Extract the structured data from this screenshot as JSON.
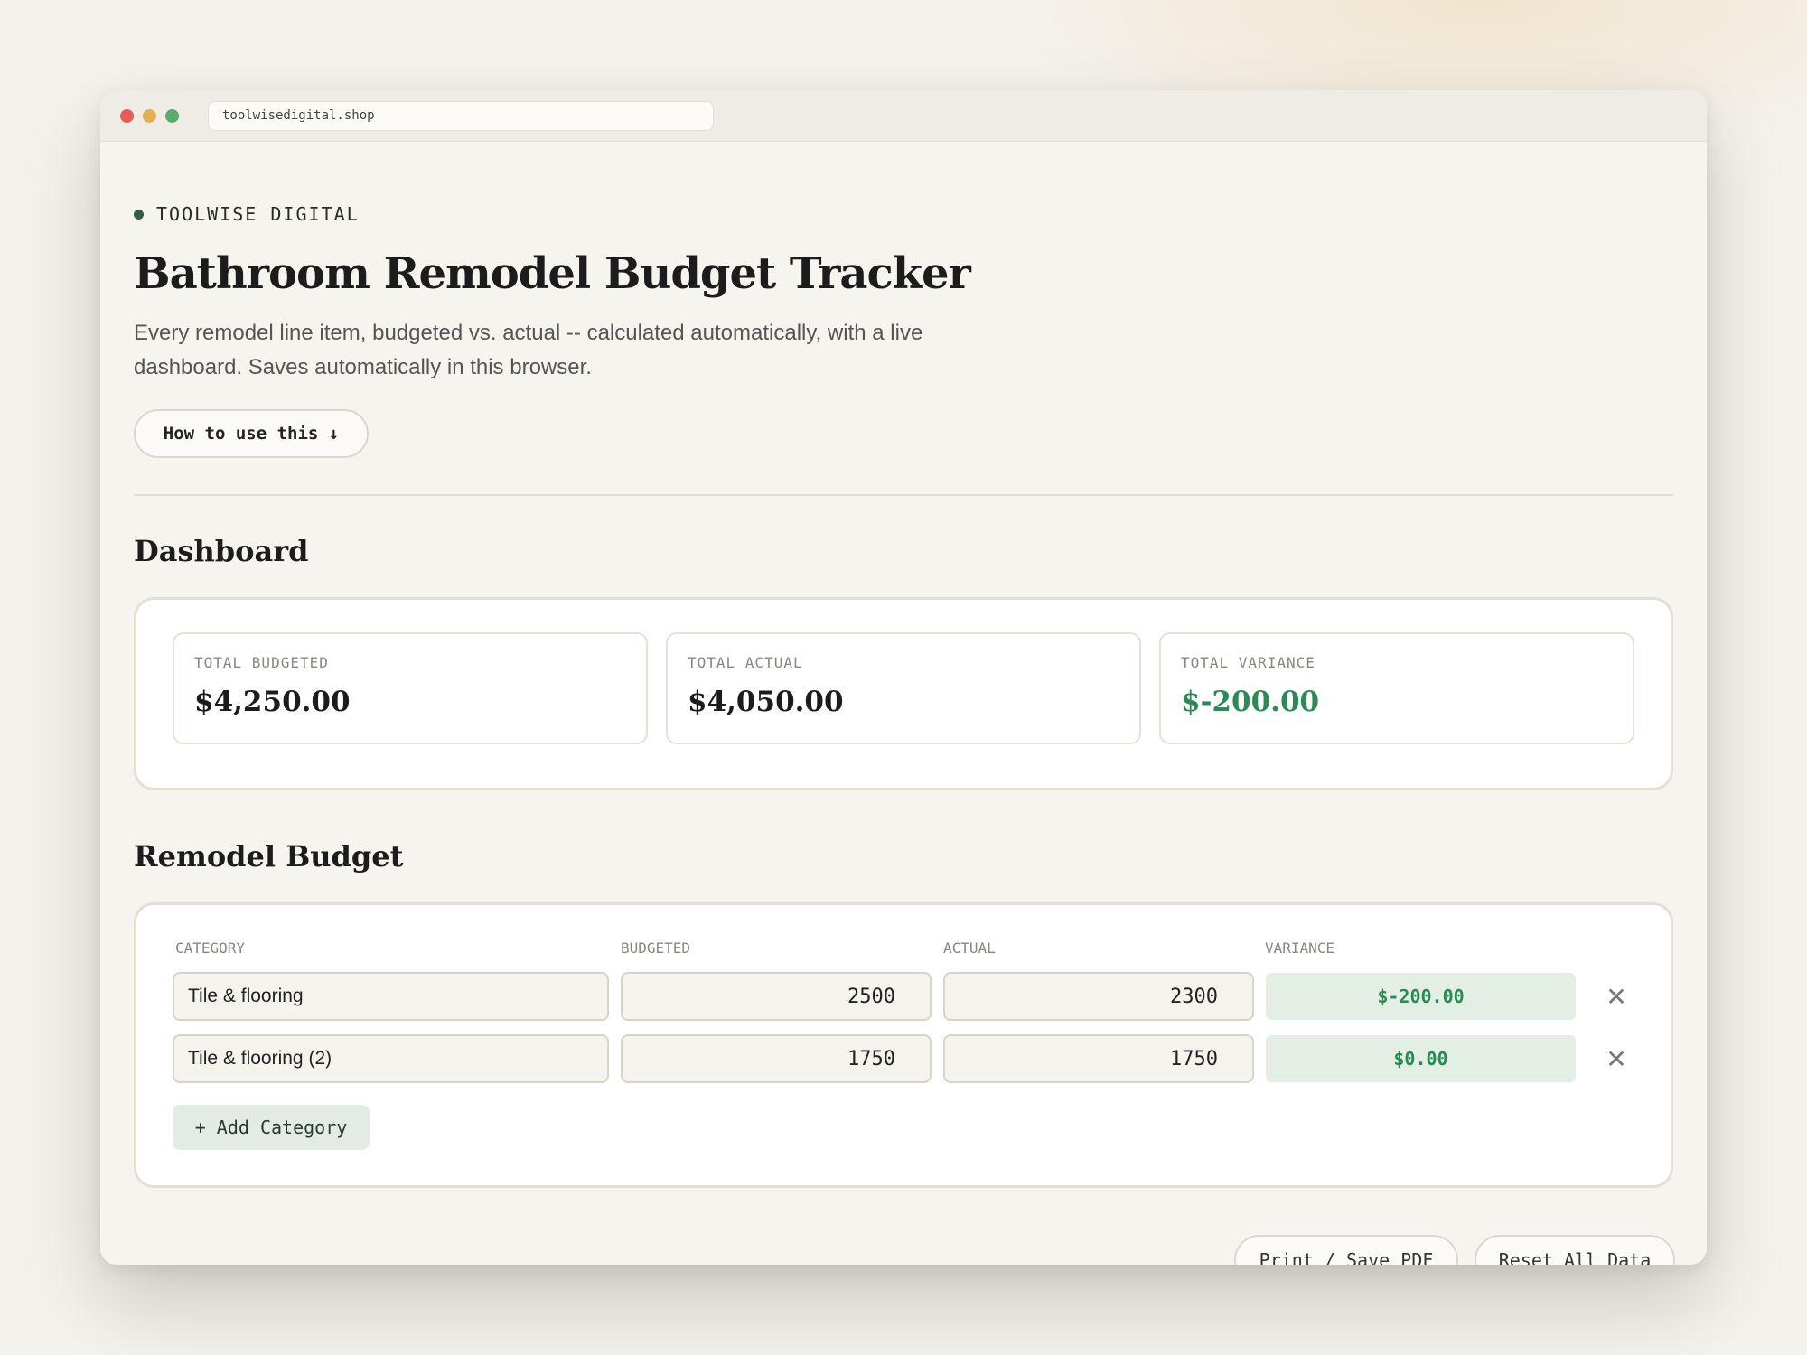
{
  "browser": {
    "url": "toolwisedigital.shop"
  },
  "header": {
    "brand": "TOOLWISE DIGITAL",
    "title": "Bathroom Remodel Budget Tracker",
    "subtitle": "Every remodel line item, budgeted vs. actual -- calculated automatically, with a live dashboard. Saves automatically in this browser.",
    "howto_label": "How to use this ↓"
  },
  "dashboard": {
    "heading": "Dashboard",
    "stats": [
      {
        "label": "TOTAL BUDGETED",
        "value": "$4,250.00"
      },
      {
        "label": "TOTAL ACTUAL",
        "value": "$4,050.00"
      },
      {
        "label": "TOTAL VARIANCE",
        "value": "$-200.00"
      }
    ]
  },
  "budget": {
    "heading": "Remodel Budget",
    "columns": [
      "CATEGORY",
      "BUDGETED",
      "ACTUAL",
      "VARIANCE"
    ],
    "rows": [
      {
        "category": "Tile & flooring",
        "budgeted": "2500",
        "actual": "2300",
        "variance": "$-200.00"
      },
      {
        "category": "Tile & flooring (2)",
        "budgeted": "1750",
        "actual": "1750",
        "variance": "$0.00"
      }
    ],
    "remove_icon": "✕",
    "add_label": "+ Add Category"
  },
  "footer": {
    "print_label": "Print / Save PDF",
    "reset_label": "Reset All Data"
  },
  "colors": {
    "accent_green": "#2d8a56",
    "brand_dot": "#2f5d4a",
    "background": "#f4f2ec"
  }
}
